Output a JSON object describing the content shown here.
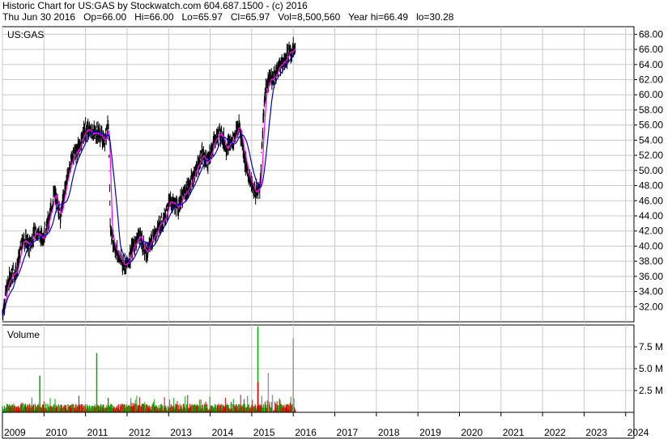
{
  "header": {
    "line1": "Historic Chart for US:GAS by Stockwatch.com 604.687.1500 - (c) 2016",
    "line2": "Thu Jun 30 2016   Op=66.00   Hi=66.00   Lo=65.97   Cl=65.97   Vol=8,500,560   Year hi=66.49   lo=30.28"
  },
  "price_panel": {
    "label": "US:GAS"
  },
  "volume_panel": {
    "label": "Volume"
  },
  "colors": {
    "price_bars": "#000000",
    "ma_fast": "#ff00ff",
    "ma_slow": "#0000cc",
    "vol_up": "#00aa00",
    "vol_down": "#dd0000",
    "vol_flat": "#999999",
    "grid": "#c8c8c8"
  },
  "chart_data": {
    "type": "line",
    "price": {
      "ylim": [
        30,
        69
      ],
      "y_ticks": [
        "32.00",
        "34.00",
        "36.00",
        "38.00",
        "40.00",
        "42.00",
        "44.00",
        "46.00",
        "48.00",
        "50.00",
        "52.00",
        "54.00",
        "56.00",
        "58.00",
        "60.00",
        "62.00",
        "64.00",
        "66.00",
        "68.00"
      ],
      "y_tick_values": [
        32,
        34,
        36,
        38,
        40,
        42,
        44,
        46,
        48,
        50,
        52,
        54,
        56,
        58,
        60,
        62,
        64,
        66,
        68
      ],
      "series": [
        {
          "x": [
            2009.0,
            2009.1,
            2009.2,
            2009.35,
            2009.5,
            2009.65,
            2009.8,
            2009.95,
            2010.1,
            2010.25,
            2010.4,
            2010.55,
            2010.7,
            2010.85,
            2011.0,
            2011.15,
            2011.3,
            2011.45,
            2011.55,
            2011.6,
            2011.7,
            2011.85,
            2012.0,
            2012.15,
            2012.3,
            2012.45,
            2012.6,
            2012.75,
            2012.9,
            2013.05,
            2013.2,
            2013.35,
            2013.5,
            2013.65,
            2013.8,
            2013.95,
            2014.1,
            2014.25,
            2014.4,
            2014.55,
            2014.7,
            2014.85,
            2015.0,
            2015.1,
            2015.2,
            2015.3,
            2015.35,
            2015.45,
            2015.6,
            2015.75,
            2015.9,
            2016.05
          ],
          "values": [
            31.0,
            34.5,
            36.0,
            37.0,
            41.0,
            40.0,
            42.0,
            41.0,
            43.0,
            47.0,
            44.0,
            49.0,
            52.0,
            53.0,
            55.5,
            55.0,
            55.0,
            54.0,
            56.0,
            42.0,
            40.0,
            38.0,
            37.5,
            40.0,
            41.5,
            39.0,
            41.0,
            42.5,
            44.0,
            46.0,
            45.0,
            46.5,
            48.0,
            50.0,
            52.0,
            51.0,
            54.0,
            55.0,
            53.0,
            54.0,
            56.0,
            51.0,
            48.0,
            47.0,
            48.0,
            59.0,
            61.0,
            62.0,
            63.0,
            64.5,
            65.5,
            66.0
          ]
        }
      ]
    },
    "volume": {
      "ylim": [
        0,
        10
      ],
      "unit": "M",
      "y_ticks": [
        "2.5 M",
        "5.0 M",
        "7.5 M"
      ],
      "y_tick_values": [
        2.5,
        5.0,
        7.5
      ],
      "spikes": [
        {
          "x": 2009.9,
          "value": 4.2
        },
        {
          "x": 2011.27,
          "value": 6.8
        },
        {
          "x": 2015.15,
          "value": 9.8
        },
        {
          "x": 2015.15,
          "value": 3.5
        },
        {
          "x": 2015.4,
          "value": 4.5
        },
        {
          "x": 2015.5,
          "value": 2.0
        },
        {
          "x": 2016.0,
          "value": 8.5
        }
      ],
      "baseline_level": 0.5
    },
    "x_axis": {
      "xlim": [
        2009.0,
        2024.2
      ],
      "tick_labels": [
        "2009",
        "2010",
        "2011",
        "2012",
        "2013",
        "2014",
        "2015",
        "2016",
        "2017",
        "2018",
        "2019",
        "2020",
        "2021",
        "2022",
        "2023",
        "2024"
      ],
      "tick_values": [
        2009,
        2010,
        2011,
        2012,
        2013,
        2014,
        2015,
        2016,
        2017,
        2018,
        2019,
        2020,
        2021,
        2022,
        2023,
        2024
      ]
    },
    "grid": true
  }
}
